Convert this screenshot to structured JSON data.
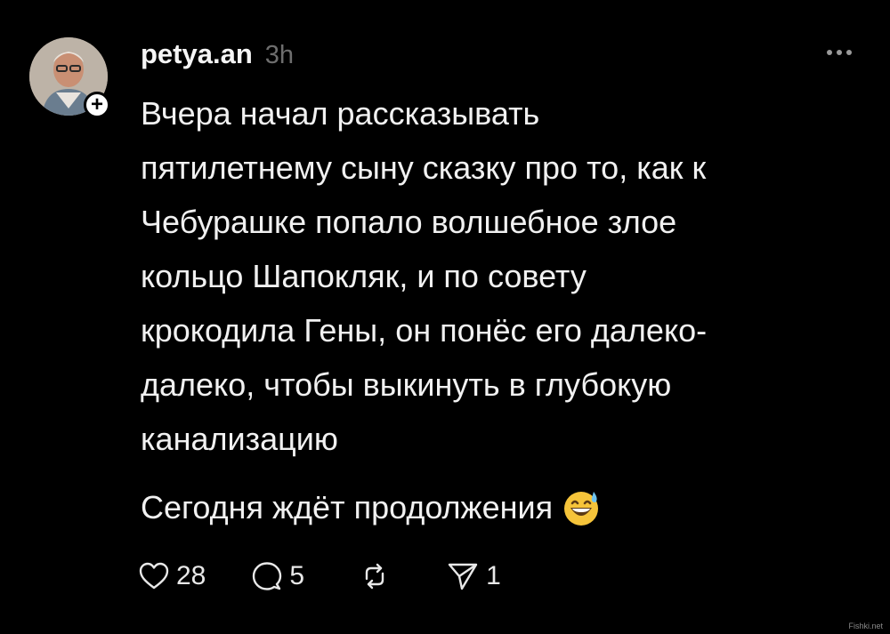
{
  "post": {
    "username": "petya.an",
    "time": "3h",
    "text_paragraph_1": "Вчера начал рассказывать\nпятилетнему сыну сказку про то, как к\nЧебурашке попало волшебное злое\nкольцо Шапокляк, и по совету\nкрокодила Гены, он понёс его далеко-\nдалеко, чтобы выкинуть в глубокую\nканализацию",
    "text_paragraph_2": "Сегодня ждёт продолжения",
    "emoji": "grinning-face-with-sweat-emoji"
  },
  "actions": {
    "likes": "28",
    "replies": "5",
    "shares": "1"
  },
  "icons": {
    "like": "heart-icon",
    "reply": "comment-icon",
    "repost": "repost-icon",
    "share": "send-icon",
    "more": "more-dots-icon",
    "follow": "plus-icon"
  },
  "watermark": "Fishki.net",
  "colors": {
    "background": "#000000",
    "text": "#f1f1f1",
    "muted": "#6e6e6e"
  }
}
